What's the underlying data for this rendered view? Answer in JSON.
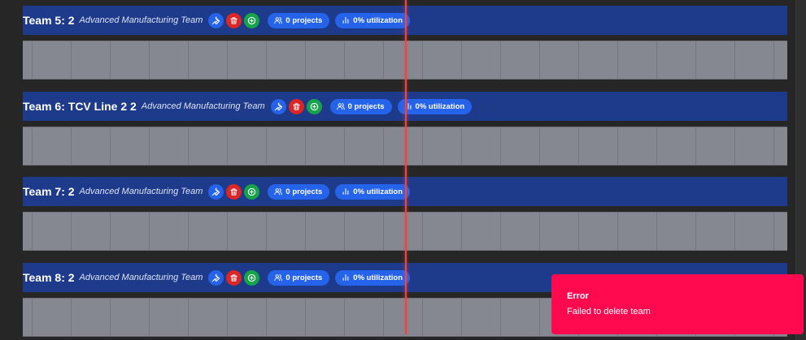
{
  "teams": [
    {
      "name": "Team 5: 2",
      "subtitle": "Advanced Manufacturing Team",
      "projects": "0 projects",
      "utilization": "0% utilization"
    },
    {
      "name": "Team 6: TCV Line 2 2",
      "subtitle": "Advanced Manufacturing Team",
      "projects": "0 projects",
      "utilization": "0% utilization"
    },
    {
      "name": "Team 7: 2",
      "subtitle": "Advanced Manufacturing Team",
      "projects": "0 projects",
      "utilization": "0% utilization"
    },
    {
      "name": "Team 8: 2",
      "subtitle": "Advanced Manufacturing Team",
      "projects": "0 projects",
      "utilization": "0% utilization"
    }
  ],
  "icons": {
    "edit": "wrench-icon",
    "delete": "trash-icon",
    "add": "plus-circle-icon",
    "projects": "users-icon",
    "utilization": "bar-chart-icon"
  },
  "colors": {
    "team_header": "#1e3a8a",
    "pill": "#2563eb",
    "delete": "#dc2626",
    "add": "#16a34a",
    "timeline": "#858891",
    "now_line": "#ef4444",
    "toast": "#ff0a4f"
  },
  "toast": {
    "title": "Error",
    "message": "Failed to delete team"
  }
}
